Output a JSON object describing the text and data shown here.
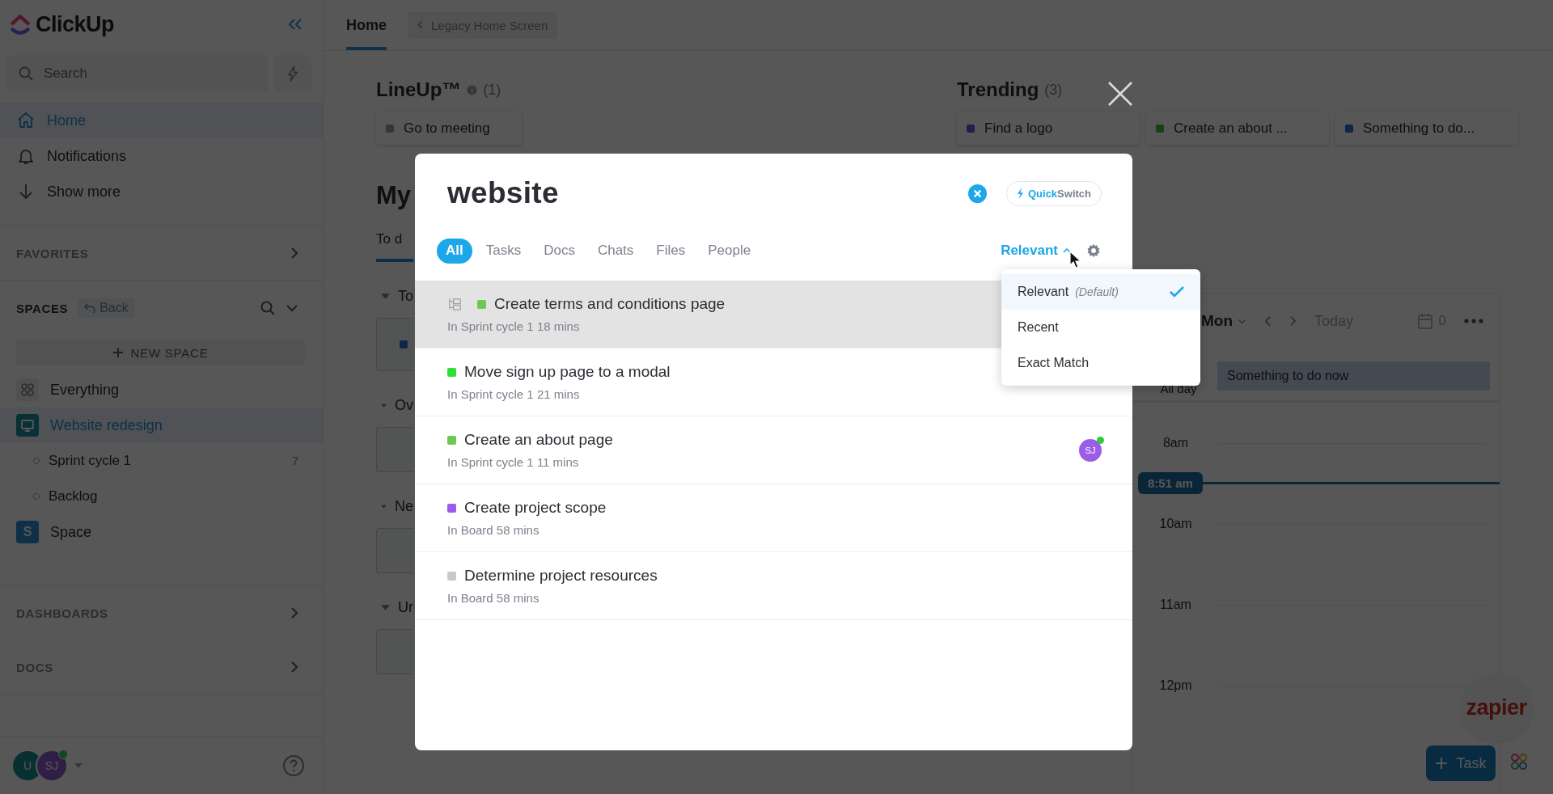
{
  "sidebar": {
    "logo": "ClickUp",
    "search": {
      "placeholder": "Search"
    },
    "nav": [
      {
        "kind": "home",
        "label": "Home",
        "selected": true
      },
      {
        "kind": "bell",
        "label": "Notifications",
        "selected": false
      },
      {
        "kind": "more",
        "label": "Show more",
        "selected": false
      }
    ],
    "favorites": {
      "title": "FAVORITES"
    },
    "spaces": {
      "title": "SPACES",
      "back": "Back",
      "new_space": "NEW SPACE",
      "items": [
        {
          "kind": "grid",
          "label": "Everything",
          "selected": false
        },
        {
          "kind": "monitor",
          "label": "Website redesign",
          "selected": true,
          "children": [
            {
              "label": "Sprint cycle 1",
              "count": "7"
            },
            {
              "label": "Backlog"
            }
          ]
        },
        {
          "kind": "letter",
          "badge": "S",
          "label": "Space",
          "selected": false
        }
      ]
    },
    "sections": [
      {
        "title": "DASHBOARDS"
      },
      {
        "title": "DOCS"
      }
    ],
    "user_avatars": [
      {
        "initials": "U",
        "color": "#0a3030",
        "online": false
      },
      {
        "initials": "SJ",
        "color": "#2f1f47",
        "online": true
      }
    ]
  },
  "header": {
    "tabs": [
      {
        "label": "Home",
        "selected": true
      }
    ],
    "legacy_button": "Legacy Home Screen"
  },
  "lineup": {
    "title": "LineUp™",
    "count": "(1)",
    "cards": [
      {
        "label": "Go to meeting"
      }
    ]
  },
  "my_work": {
    "title": "My",
    "tab": "To d",
    "sections": [
      {
        "title": "To"
      },
      {
        "title": "Ov"
      },
      {
        "title": "Ne"
      },
      {
        "title": "Ur"
      }
    ]
  },
  "trending": {
    "title": "Trending",
    "count": "(3)",
    "cards": [
      {
        "label": "Find a logo",
        "color": "#2a1b49"
      },
      {
        "label": "Create an about ...",
        "color": "#153f15"
      },
      {
        "label": "Something to do...",
        "color": "#102647"
      }
    ]
  },
  "calendar": {
    "day": "Mon",
    "today": "Today",
    "count": "0",
    "all_day_label": "All day",
    "all_day_event": "Something to do now",
    "hours": [
      "8am",
      "10am",
      "11am",
      "12pm"
    ],
    "now": "8:51 am"
  },
  "zapier": "zapier",
  "task_button": "Task",
  "modal": {
    "query": "website",
    "quickswitch": {
      "highlight": "Quick",
      "rest": "Switch"
    },
    "filters": [
      {
        "label": "All",
        "selected": true
      },
      {
        "label": "Tasks",
        "selected": false
      },
      {
        "label": "Docs",
        "selected": false
      },
      {
        "label": "Chats",
        "selected": false
      },
      {
        "label": "Files",
        "selected": false
      },
      {
        "label": "People",
        "selected": false
      }
    ],
    "sort": {
      "label": "Relevant",
      "open": true
    },
    "results": [
      {
        "title": "Create terms and conditions page",
        "meta": "In Sprint cycle 1 18 mins",
        "color": "#6bc950",
        "highlighted": true
      },
      {
        "title": "Move sign up page to a modal",
        "meta": "In Sprint cycle 1 21 mins",
        "color": "#2fe03a",
        "highlighted": false
      },
      {
        "title": "Create an about page",
        "meta": "In Sprint cycle 1 11 mins",
        "color": "#6bc950",
        "highlighted": false,
        "assignee": {
          "initials": "SJ",
          "online": true
        }
      },
      {
        "title": "Create project scope",
        "meta": "In Board 58 mins",
        "color": "#9b5de5",
        "highlighted": false
      },
      {
        "title": "Determine project resources",
        "meta": "In Board 58 mins",
        "color": "#c8c8c8",
        "highlighted": false
      }
    ],
    "sort_menu": [
      {
        "label": "Relevant",
        "note": "(Default)",
        "selected": true
      },
      {
        "label": "Recent",
        "selected": false
      },
      {
        "label": "Exact Match",
        "selected": false
      }
    ]
  }
}
